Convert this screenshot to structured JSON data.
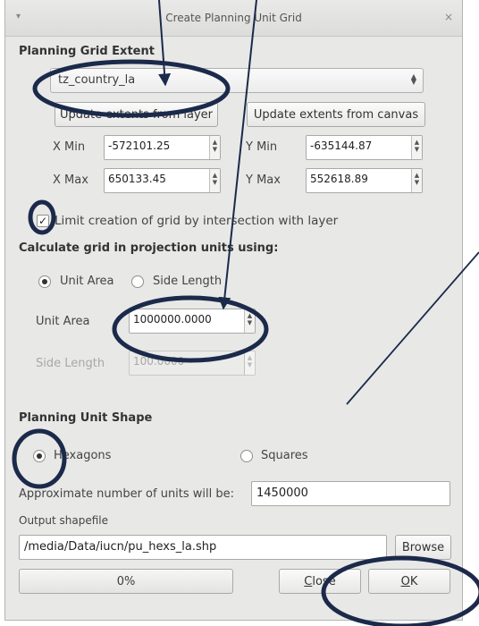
{
  "window": {
    "title": "Create Planning Unit Grid",
    "menu_glyph": "▾",
    "close_glyph": "×"
  },
  "extent": {
    "title": "Planning Grid Extent",
    "layer_combo": "tz_country_la",
    "update_layer_btn": "Update extents from layer",
    "update_canvas_btn": "Update extents from canvas",
    "xmin_label": "X Min",
    "xmin_value": "-572101.25",
    "ymin_label": "Y Min",
    "ymin_value": "-635144.87",
    "xmax_label": "X Max",
    "xmax_value": "650133.45",
    "ymax_label": "Y Max",
    "ymax_value": "552618.89",
    "limit_label": "Limit creation of grid by intersection with layer",
    "limit_checked": true
  },
  "calc": {
    "title": "Calculate grid in projection units using:",
    "unit_area_radio": "Unit Area",
    "side_length_radio": "Side Length",
    "unit_area_label": "Unit Area",
    "unit_area_value": "1000000.0000",
    "side_length_label": "Side Length",
    "side_length_value": "100.0000"
  },
  "shape": {
    "title": "Planning Unit Shape",
    "hexagons": "Hexagons",
    "squares": "Squares",
    "selected": "Hexagons"
  },
  "approx": {
    "label": "Approximate number of units will be:",
    "value": "1450000"
  },
  "output": {
    "label": "Output shapefile",
    "path": "/media/Data/iucn/pu_hexs_la.shp",
    "browse": "Browse"
  },
  "footer": {
    "progress": "0%",
    "close_mn": "C",
    "close_rest": "lose",
    "ok_mn": "O",
    "ok_rest": "K"
  },
  "colors": {
    "annotation": "#1b2a4a"
  }
}
